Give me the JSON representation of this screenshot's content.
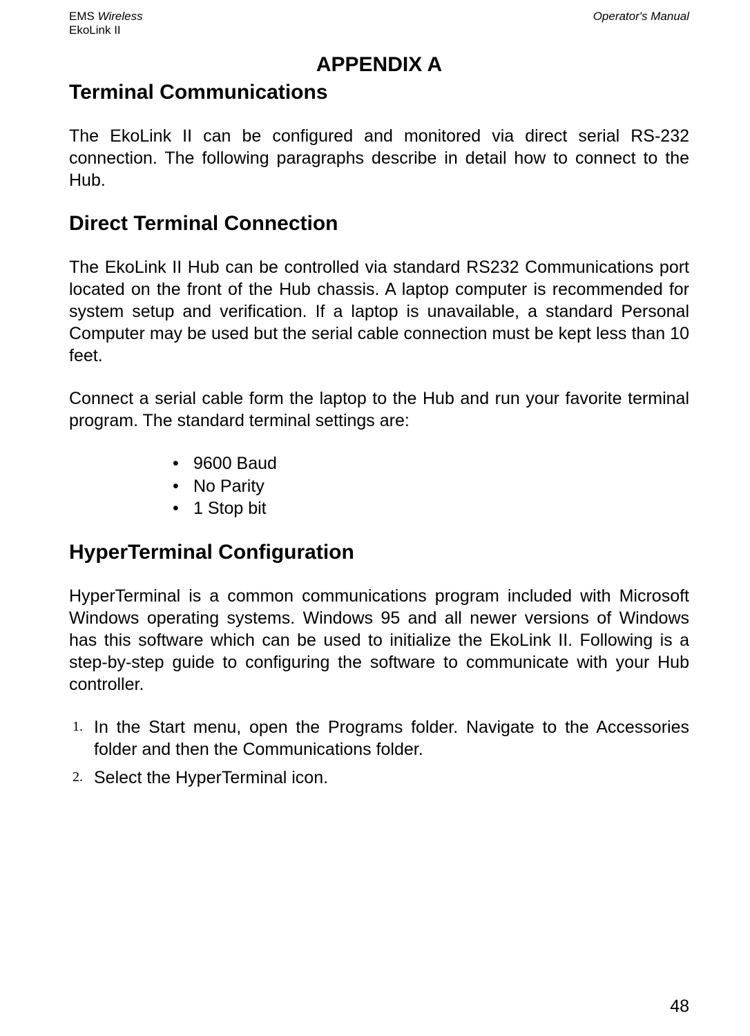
{
  "header": {
    "left_line1_prefix": "EMS ",
    "left_line1_italic": "Wireless",
    "left_line2": "EkoLink II",
    "right": "Operator's Manual"
  },
  "appendix_title": "APPENDIX A",
  "section1": {
    "title": "Terminal Communications",
    "para1": "The EkoLink II can be configured and monitored via direct serial RS-232 connection.  The following paragraphs describe in detail how to connect to the Hub."
  },
  "section2": {
    "title": "Direct Terminal Connection",
    "para1": "The EkoLink II Hub can be controlled via standard RS232 Communications port located on the front of the Hub chassis.  A laptop computer is recommended for system setup and verification.  If a laptop is unavailable, a standard Personal Computer may be used but the serial cable connection must be kept less than 10 feet.",
    "para2": "Connect a serial cable form the laptop to the Hub and run your favorite terminal program.  The standard terminal settings are:",
    "bullets": [
      "9600 Baud",
      "No Parity",
      "1 Stop bit"
    ]
  },
  "section3": {
    "title": "HyperTerminal Configuration",
    "para1": "HyperTerminal is a common communications program included with Microsoft Windows operating systems.  Windows 95 and all newer versions of Windows has this software which can be used to initialize the EkoLink II.  Following is a step-by-step guide to configuring the software to communicate with your Hub controller.",
    "steps": [
      "In the Start menu, open the Programs folder. Navigate to the Accessories folder and then the Communications folder.",
      "Select the HyperTerminal icon."
    ]
  },
  "page_number": "48"
}
